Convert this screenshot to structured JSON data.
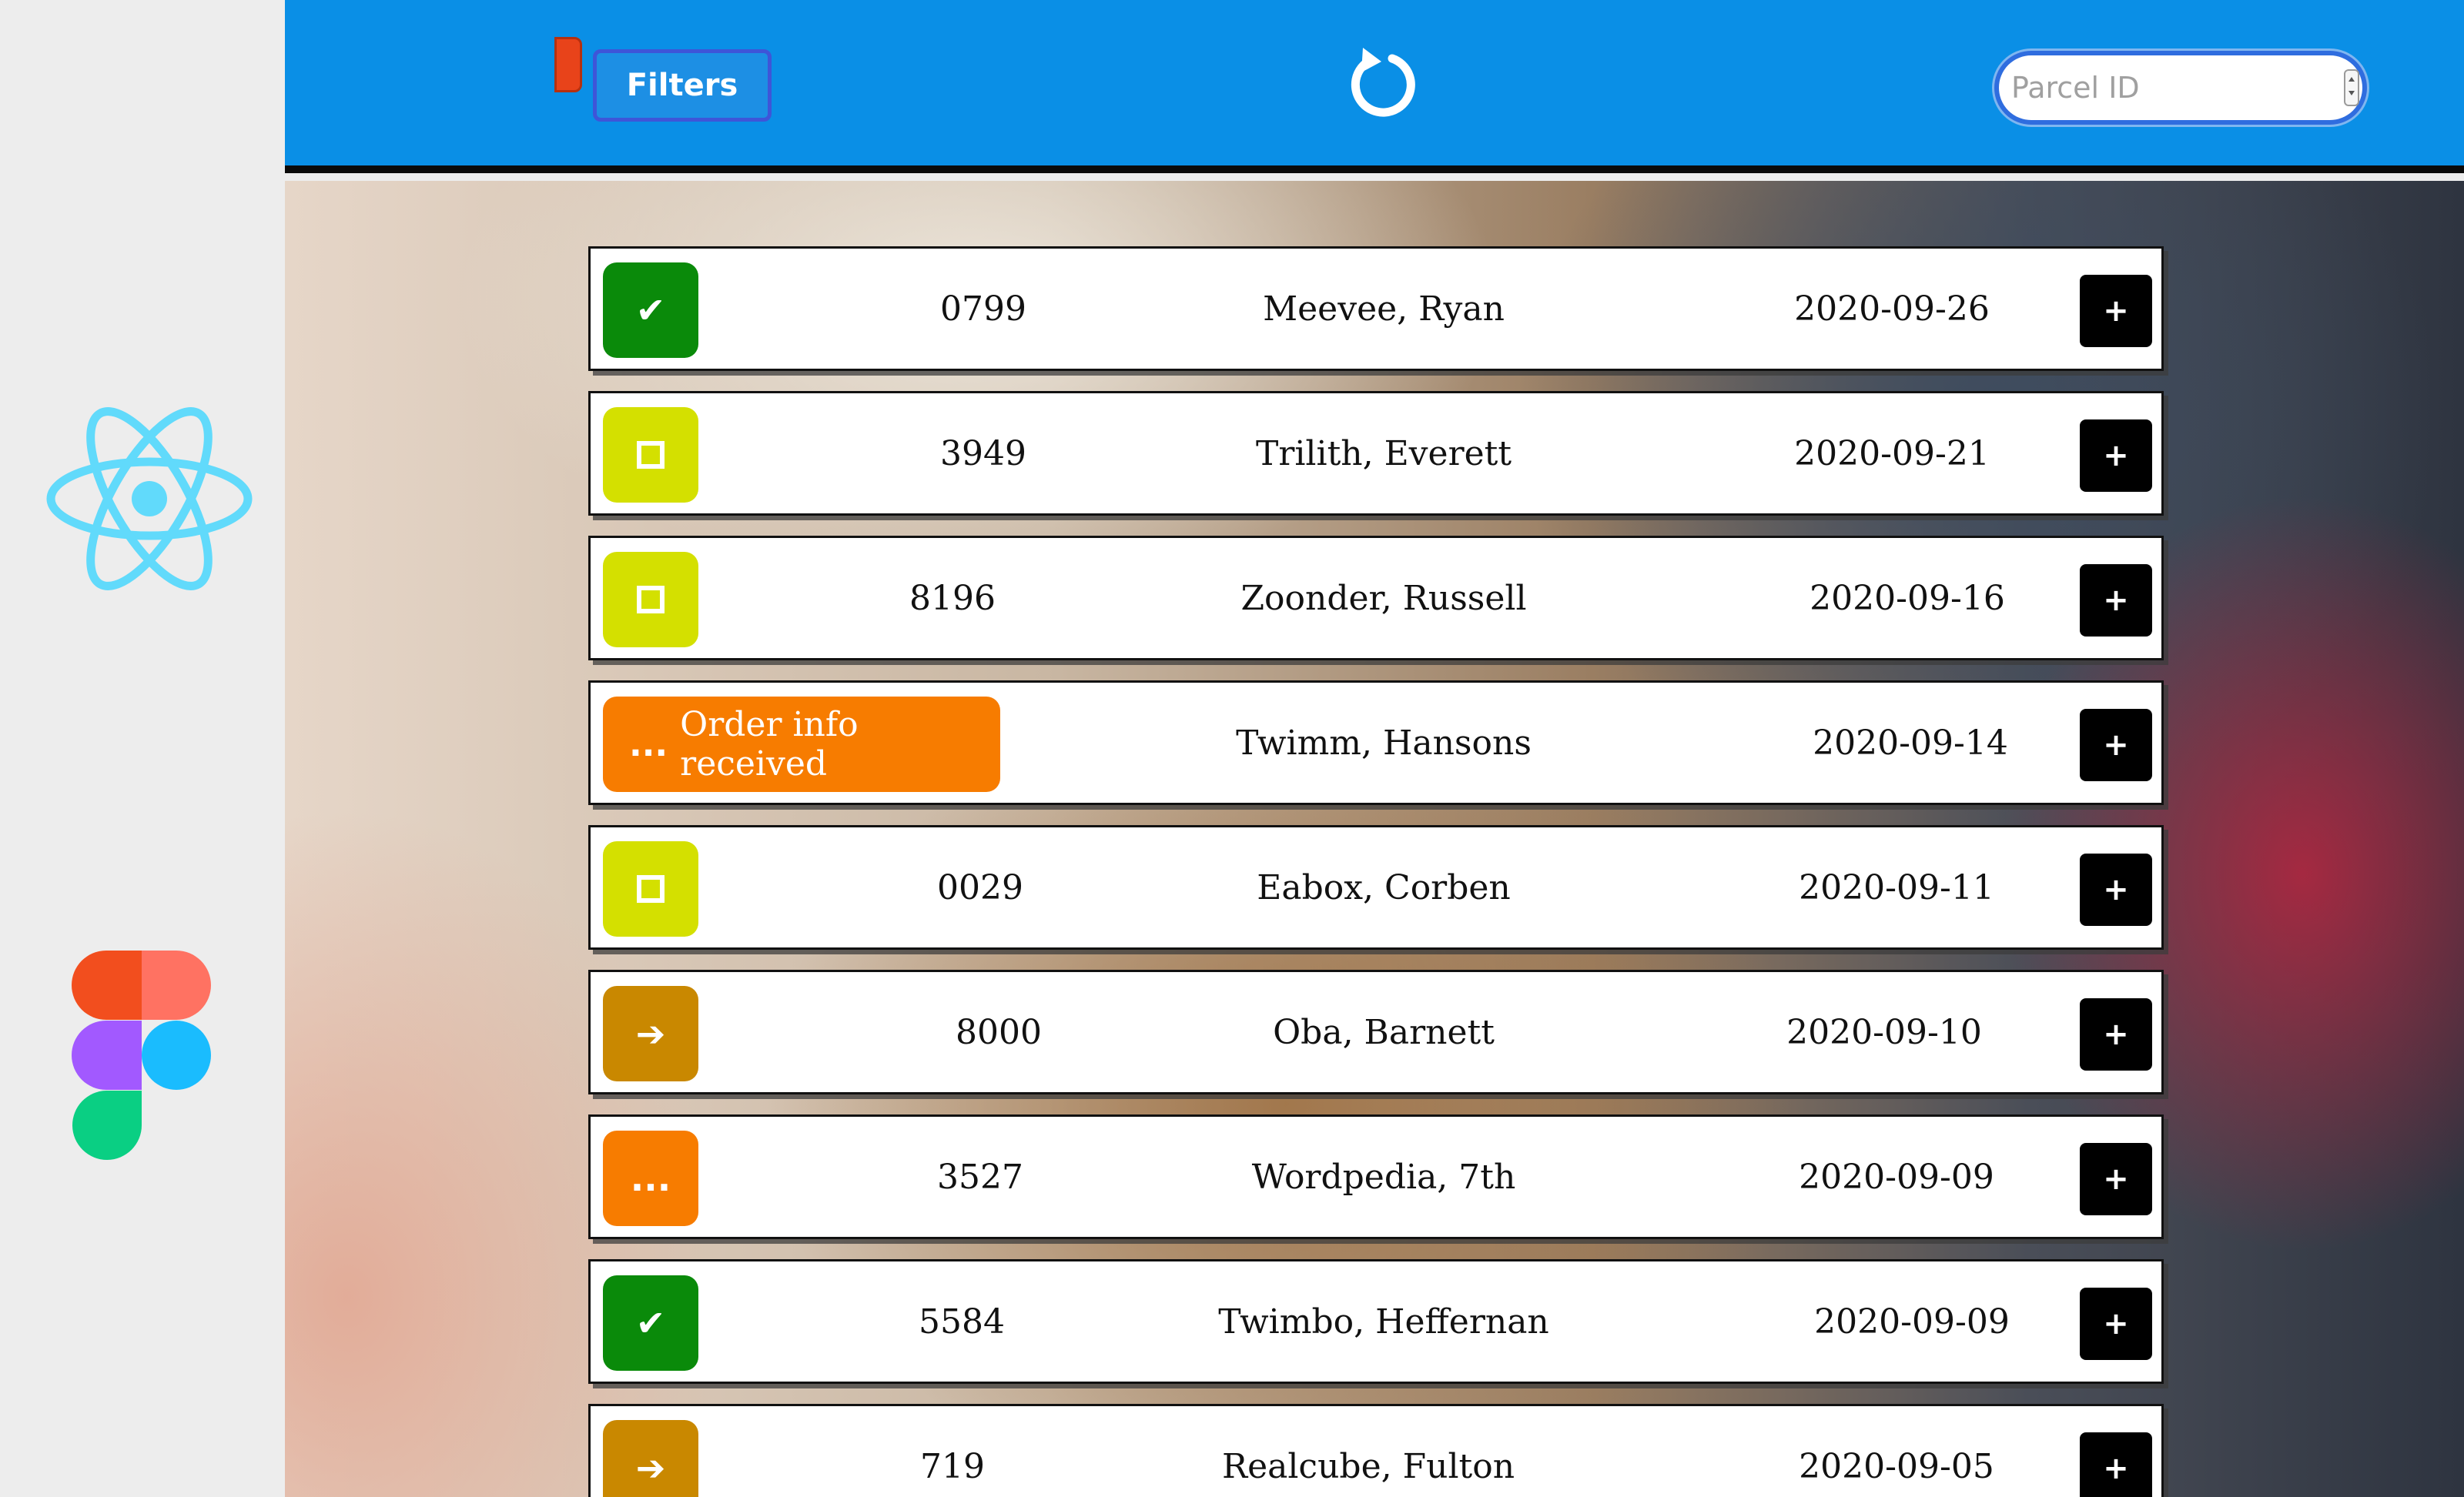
{
  "colors": {
    "header": "#0a8fe6",
    "delivered": "#0a8a0a",
    "pending": "#d4e000",
    "processing": "#f77c00",
    "in_transit": "#c98800",
    "add_button": "#000000"
  },
  "header": {
    "filters_label": "Filters",
    "refresh_icon": "refresh-icon",
    "search": {
      "placeholder": "Parcel ID",
      "value": ""
    }
  },
  "sidebar": {
    "logos": [
      "react-logo",
      "figma-logo"
    ]
  },
  "parcels": [
    {
      "id": "0799",
      "name": "Meevee, Ryan",
      "date": "2020-09-26",
      "status": "delivered",
      "status_icon": "check-icon",
      "status_text": "✔",
      "expand": "+"
    },
    {
      "id": "3949",
      "name": "Trilith, Everett",
      "date": "2020-09-21",
      "status": "pending",
      "status_icon": "square-icon",
      "status_text": "",
      "expand": "+"
    },
    {
      "id": "8196",
      "name": "Zoonder, Russell",
      "date": "2020-09-16",
      "status": "pending",
      "status_icon": "square-icon",
      "status_text": "",
      "expand": "+"
    },
    {
      "id": "",
      "name": "Twimm, Hansons",
      "date": "2020-09-14",
      "status": "processing",
      "status_icon": "dots-icon",
      "status_text": "...",
      "status_label": "Order info received",
      "expand": "+"
    },
    {
      "id": "0029",
      "name": "Eabox, Corben",
      "date": "2020-09-11",
      "status": "pending",
      "status_icon": "square-icon",
      "status_text": "",
      "expand": "+"
    },
    {
      "id": "8000",
      "name": "Oba, Barnett",
      "date": "2020-09-10",
      "status": "in_transit",
      "status_icon": "arrow-right-icon",
      "status_text": "➔",
      "expand": "+"
    },
    {
      "id": "3527",
      "name": "Wordpedia, 7th",
      "date": "2020-09-09",
      "status": "processing",
      "status_icon": "dots-icon",
      "status_text": "...",
      "expand": "+"
    },
    {
      "id": "5584",
      "name": "Twimbo, Heffernan",
      "date": "2020-09-09",
      "status": "delivered",
      "status_icon": "check-icon",
      "status_text": "✔",
      "expand": "+"
    },
    {
      "id": "719",
      "name": "Realcube, Fulton",
      "date": "2020-09-05",
      "status": "in_transit",
      "status_icon": "arrow-right-icon",
      "status_text": "➔",
      "expand": "+"
    }
  ]
}
